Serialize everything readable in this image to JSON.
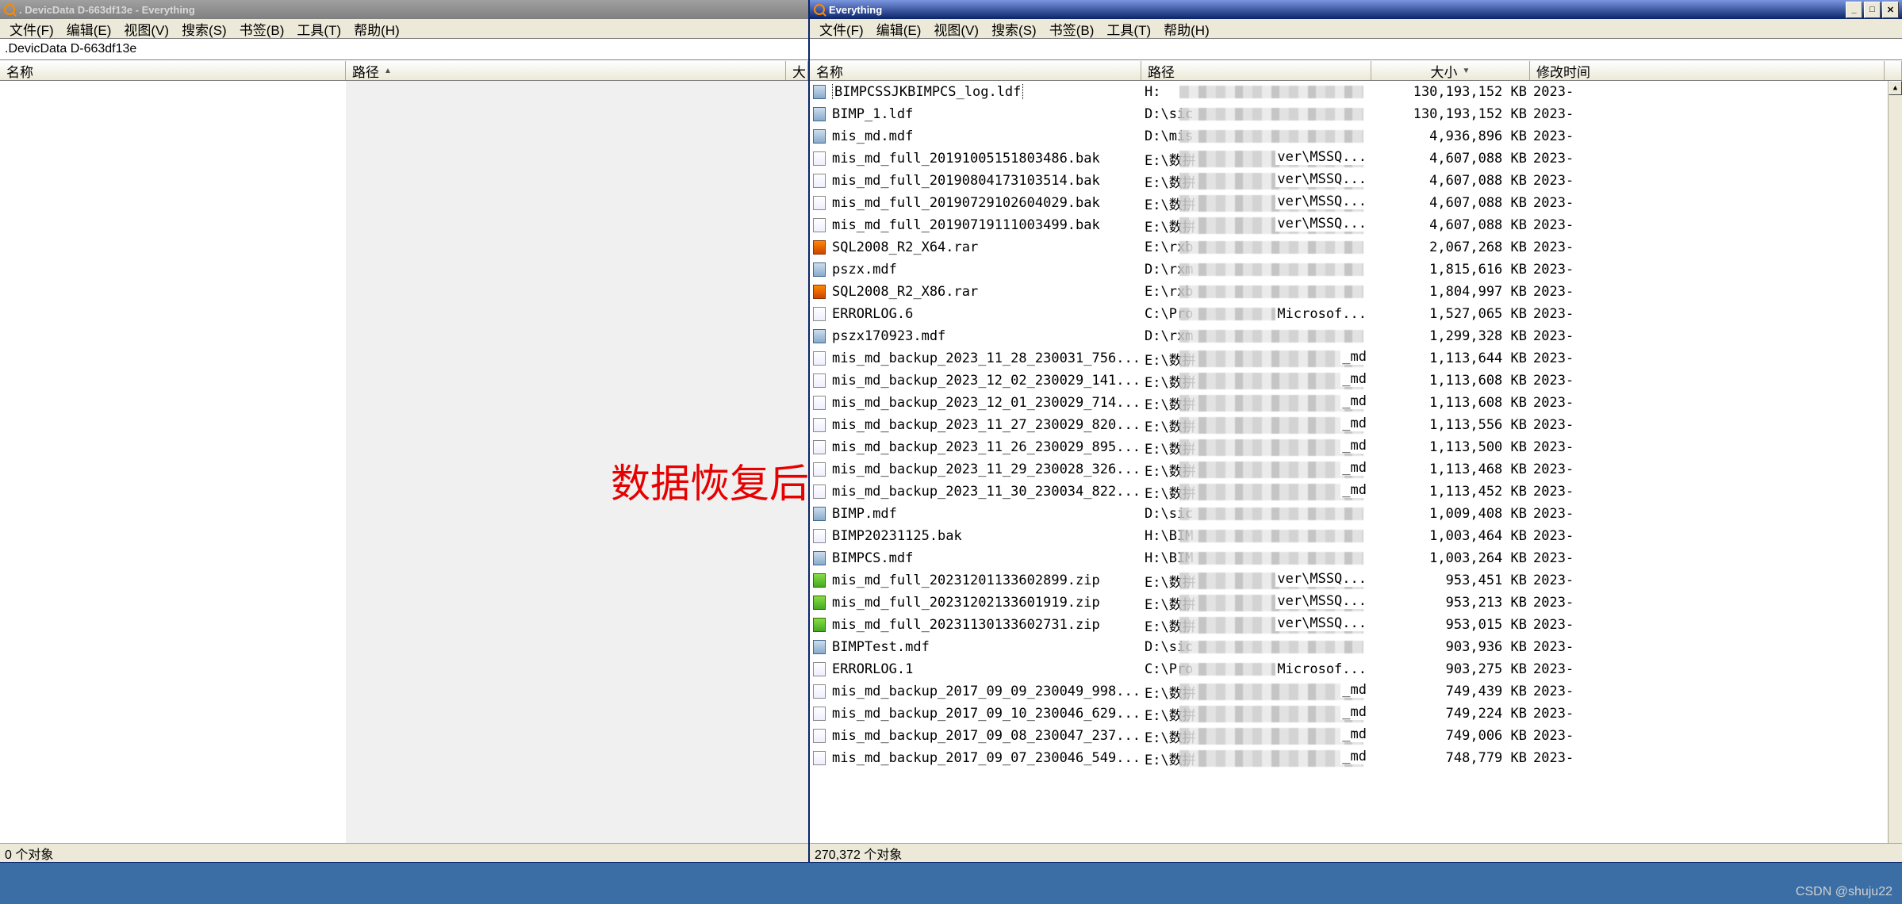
{
  "overlay_text": "数据恢复后",
  "watermark": "CSDN @shuju22",
  "menu": {
    "file": "文件(F)",
    "edit": "编辑(E)",
    "view": "视图(V)",
    "search": "搜索(S)",
    "bookmark": "书签(B)",
    "tools": "工具(T)",
    "help": "帮助(H)"
  },
  "columns": {
    "name": "名称",
    "path": "路径",
    "size": "大小",
    "modified": "修改时间"
  },
  "left": {
    "title": ". DevicData D-663df13e - Everything",
    "search_value": ".DevicData D-663df13e",
    "status": "0 个对象",
    "extra_col": "大"
  },
  "right": {
    "title": "Everything",
    "search_value": "",
    "status": "270,372 个对象",
    "rows": [
      {
        "icon": "db",
        "name": "BIMPCSSJKBIMPCS_log.ldf",
        "path": "H:",
        "size": "130,193,152 KB",
        "date": "2023-",
        "sel": true
      },
      {
        "icon": "db",
        "name": "BIMP_1.ldf",
        "path": "D:\\sic",
        "size": "130,193,152 KB",
        "date": "2023-"
      },
      {
        "icon": "db",
        "name": "mis_md.mdf",
        "path": "D:\\mis",
        "size": "4,936,896 KB",
        "date": "2023-"
      },
      {
        "icon": "generic",
        "name": "mis_md_full_20191005151803486.bak",
        "path": "E:\\数拼",
        "path2": "ver\\MSSQ...",
        "size": "4,607,088 KB",
        "date": "2023-"
      },
      {
        "icon": "generic",
        "name": "mis_md_full_20190804173103514.bak",
        "path": "E:\\数拼",
        "path2": "ver\\MSSQ...",
        "size": "4,607,088 KB",
        "date": "2023-"
      },
      {
        "icon": "generic",
        "name": "mis_md_full_20190729102604029.bak",
        "path": "E:\\数拼",
        "path2": "ver\\MSSQ...",
        "size": "4,607,088 KB",
        "date": "2023-"
      },
      {
        "icon": "generic",
        "name": "mis_md_full_20190719111003499.bak",
        "path": "E:\\数拼",
        "path2": "ver\\MSSQ...",
        "size": "4,607,088 KB",
        "date": "2023-"
      },
      {
        "icon": "rar",
        "name": "SQL2008_R2_X64.rar",
        "path": "E:\\rxb",
        "size": "2,067,268 KB",
        "date": "2023-"
      },
      {
        "icon": "db",
        "name": "pszx.mdf",
        "path": "D:\\rxm",
        "size": "1,815,616 KB",
        "date": "2023-"
      },
      {
        "icon": "rar",
        "name": "SQL2008_R2_X86.rar",
        "path": "E:\\rxb",
        "size": "1,804,997 KB",
        "date": "2023-"
      },
      {
        "icon": "generic",
        "name": "ERRORLOG.6",
        "path": "C:\\Pro",
        "path2": "Microsof...",
        "size": "1,527,065 KB",
        "date": "2023-"
      },
      {
        "icon": "db",
        "name": "pszx170923.mdf",
        "path": "D:\\rxm",
        "size": "1,299,328 KB",
        "date": "2023-"
      },
      {
        "icon": "generic",
        "name": "mis_md_backup_2023_11_28_230031_756...",
        "path": "E:\\数拼",
        "path2": "_md",
        "size": "1,113,644 KB",
        "date": "2023-"
      },
      {
        "icon": "generic",
        "name": "mis_md_backup_2023_12_02_230029_141...",
        "path": "E:\\数拼",
        "path2": "_md",
        "size": "1,113,608 KB",
        "date": "2023-"
      },
      {
        "icon": "generic",
        "name": "mis_md_backup_2023_12_01_230029_714...",
        "path": "E:\\数拼",
        "path2": "_md",
        "size": "1,113,608 KB",
        "date": "2023-"
      },
      {
        "icon": "generic",
        "name": "mis_md_backup_2023_11_27_230029_820...",
        "path": "E:\\数拼",
        "path2": "_md",
        "size": "1,113,556 KB",
        "date": "2023-"
      },
      {
        "icon": "generic",
        "name": "mis_md_backup_2023_11_26_230029_895...",
        "path": "E:\\数拼",
        "path2": "_md",
        "size": "1,113,500 KB",
        "date": "2023-"
      },
      {
        "icon": "generic",
        "name": "mis_md_backup_2023_11_29_230028_326...",
        "path": "E:\\数拼",
        "path2": "_md",
        "size": "1,113,468 KB",
        "date": "2023-"
      },
      {
        "icon": "generic",
        "name": "mis_md_backup_2023_11_30_230034_822...",
        "path": "E:\\数拼",
        "path2": "_md",
        "size": "1,113,452 KB",
        "date": "2023-"
      },
      {
        "icon": "db",
        "name": "BIMP.mdf",
        "path": "D:\\sic",
        "size": "1,009,408 KB",
        "date": "2023-"
      },
      {
        "icon": "generic",
        "name": "BIMP20231125.bak",
        "path": "H:\\BIM",
        "size": "1,003,464 KB",
        "date": "2023-"
      },
      {
        "icon": "db",
        "name": "BIMPCS.mdf",
        "path": "H:\\BIM",
        "size": "1,003,264 KB",
        "date": "2023-"
      },
      {
        "icon": "zip",
        "name": "mis_md_full_20231201133602899.zip",
        "path": "E:\\数拼",
        "path2": "ver\\MSSQ...",
        "size": "953,451 KB",
        "date": "2023-"
      },
      {
        "icon": "zip",
        "name": "mis_md_full_20231202133601919.zip",
        "path": "E:\\数拼",
        "path2": "ver\\MSSQ...",
        "size": "953,213 KB",
        "date": "2023-"
      },
      {
        "icon": "zip",
        "name": "mis_md_full_20231130133602731.zip",
        "path": "E:\\数拼",
        "path2": "ver\\MSSQ...",
        "size": "953,015 KB",
        "date": "2023-"
      },
      {
        "icon": "db",
        "name": "BIMPTest.mdf",
        "path": "D:\\sic",
        "size": "903,936 KB",
        "date": "2023-"
      },
      {
        "icon": "generic",
        "name": "ERRORLOG.1",
        "path": "C:\\Pro",
        "path2": "Microsof...",
        "size": "903,275 KB",
        "date": "2023-"
      },
      {
        "icon": "generic",
        "name": "mis_md_backup_2017_09_09_230049_998...",
        "path": "E:\\数拼",
        "path2": "_md",
        "size": "749,439 KB",
        "date": "2023-"
      },
      {
        "icon": "generic",
        "name": "mis_md_backup_2017_09_10_230046_629...",
        "path": "E:\\数拼",
        "path2": "_md",
        "size": "749,224 KB",
        "date": "2023-"
      },
      {
        "icon": "generic",
        "name": "mis_md_backup_2017_09_08_230047_237...",
        "path": "E:\\数拼",
        "path2": "_md",
        "size": "749,006 KB",
        "date": "2023-"
      },
      {
        "icon": "generic",
        "name": "mis_md_backup_2017_09_07_230046_549...",
        "path": "E:\\数拼",
        "path2": "_md",
        "size": "748,779 KB",
        "date": "2023-"
      }
    ]
  }
}
